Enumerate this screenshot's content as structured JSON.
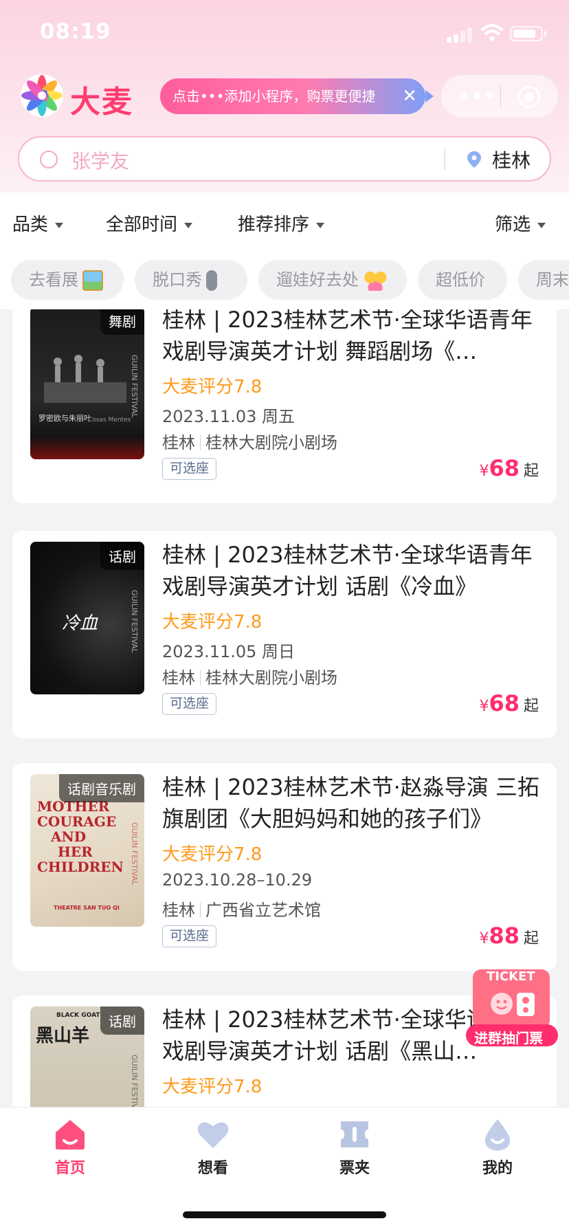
{
  "status": {
    "time": "08:19"
  },
  "header": {
    "brand": "大麦",
    "mini_tip": "点击•••添加小程序，购票更便捷",
    "mini_tip_close": "✕"
  },
  "search": {
    "placeholder": "张学友",
    "city": "桂林"
  },
  "filters": [
    {
      "label": "品类"
    },
    {
      "label": "全部时间"
    },
    {
      "label": "推荐排序"
    },
    {
      "label": "筛选"
    }
  ],
  "chips": [
    {
      "label": "去看展",
      "icon": "picture-emoji-icon"
    },
    {
      "label": "脱口秀",
      "icon": "microphone-emoji-icon"
    },
    {
      "label": "遛娃好去处",
      "icon": "family-emoji-icon"
    },
    {
      "label": "超低价",
      "icon": ""
    },
    {
      "label": "周末",
      "icon": ""
    }
  ],
  "events": [
    {
      "tag": "舞剧",
      "title": "桂林 | 2023桂林艺术节·全球华语青年戏剧导演英才计划 舞蹈剧场《…",
      "rating": "大麦评分7.8",
      "date": "2023.11.03 周五",
      "city": "桂林",
      "venue": "桂林大剧院小剧场",
      "seat": "可选座",
      "currency": "¥",
      "price": "68",
      "price_suffix": "起"
    },
    {
      "tag": "话剧",
      "title": "桂林 | 2023桂林艺术节·全球华语青年戏剧导演英才计划 话剧《冷血》",
      "rating": "大麦评分7.8",
      "date": "2023.11.05 周日",
      "city": "桂林",
      "venue": "桂林大剧院小剧场",
      "seat": "可选座",
      "currency": "¥",
      "price": "68",
      "price_suffix": "起"
    },
    {
      "tag": "话剧音乐剧",
      "title": "桂林 | 2023桂林艺术节·赵淼导演 三拓旗剧团《大胆妈妈和她的孩子们》",
      "rating": "大麦评分7.8",
      "date": "2023.10.28–10.29",
      "city": "桂林",
      "venue": "广西省立艺术馆",
      "seat": "可选座",
      "currency": "¥",
      "price": "88",
      "price_suffix": "起"
    },
    {
      "tag": "话剧",
      "title": "桂林 | 2023桂林艺术节·全球华语青年戏剧导演英才计划 话剧《黑山…",
      "rating": "大麦评分7.8",
      "date": "",
      "city": "",
      "venue": "",
      "seat": "",
      "currency": "",
      "price": "",
      "price_suffix": ""
    }
  ],
  "posters": {
    "p1_caption": "Cosas Mentes",
    "p1_vertical": "GUILIN FESTIVAL",
    "p2_title": "冷血",
    "p2_vertical": "GUILIN FESTIVAL",
    "p3_lines": [
      "MOTHER",
      "COURAGE",
      "AND",
      "HER",
      "CHILDREN"
    ],
    "p3_footer": "THEATRE SAN TUO QI",
    "p4_top": "BLACK GOAT",
    "p4_title": "黑山羊"
  },
  "ticket_badge": {
    "top": "TICKET",
    "bottom": "进群抽门票"
  },
  "tabbar": [
    {
      "label": "首页",
      "active": true
    },
    {
      "label": "想看",
      "active": false
    },
    {
      "label": "票夹",
      "active": false
    },
    {
      "label": "我的",
      "active": false
    }
  ],
  "colors": {
    "accent": "#ff3d6e",
    "rating": "#ff9a1a",
    "price": "#ff2d6e"
  }
}
